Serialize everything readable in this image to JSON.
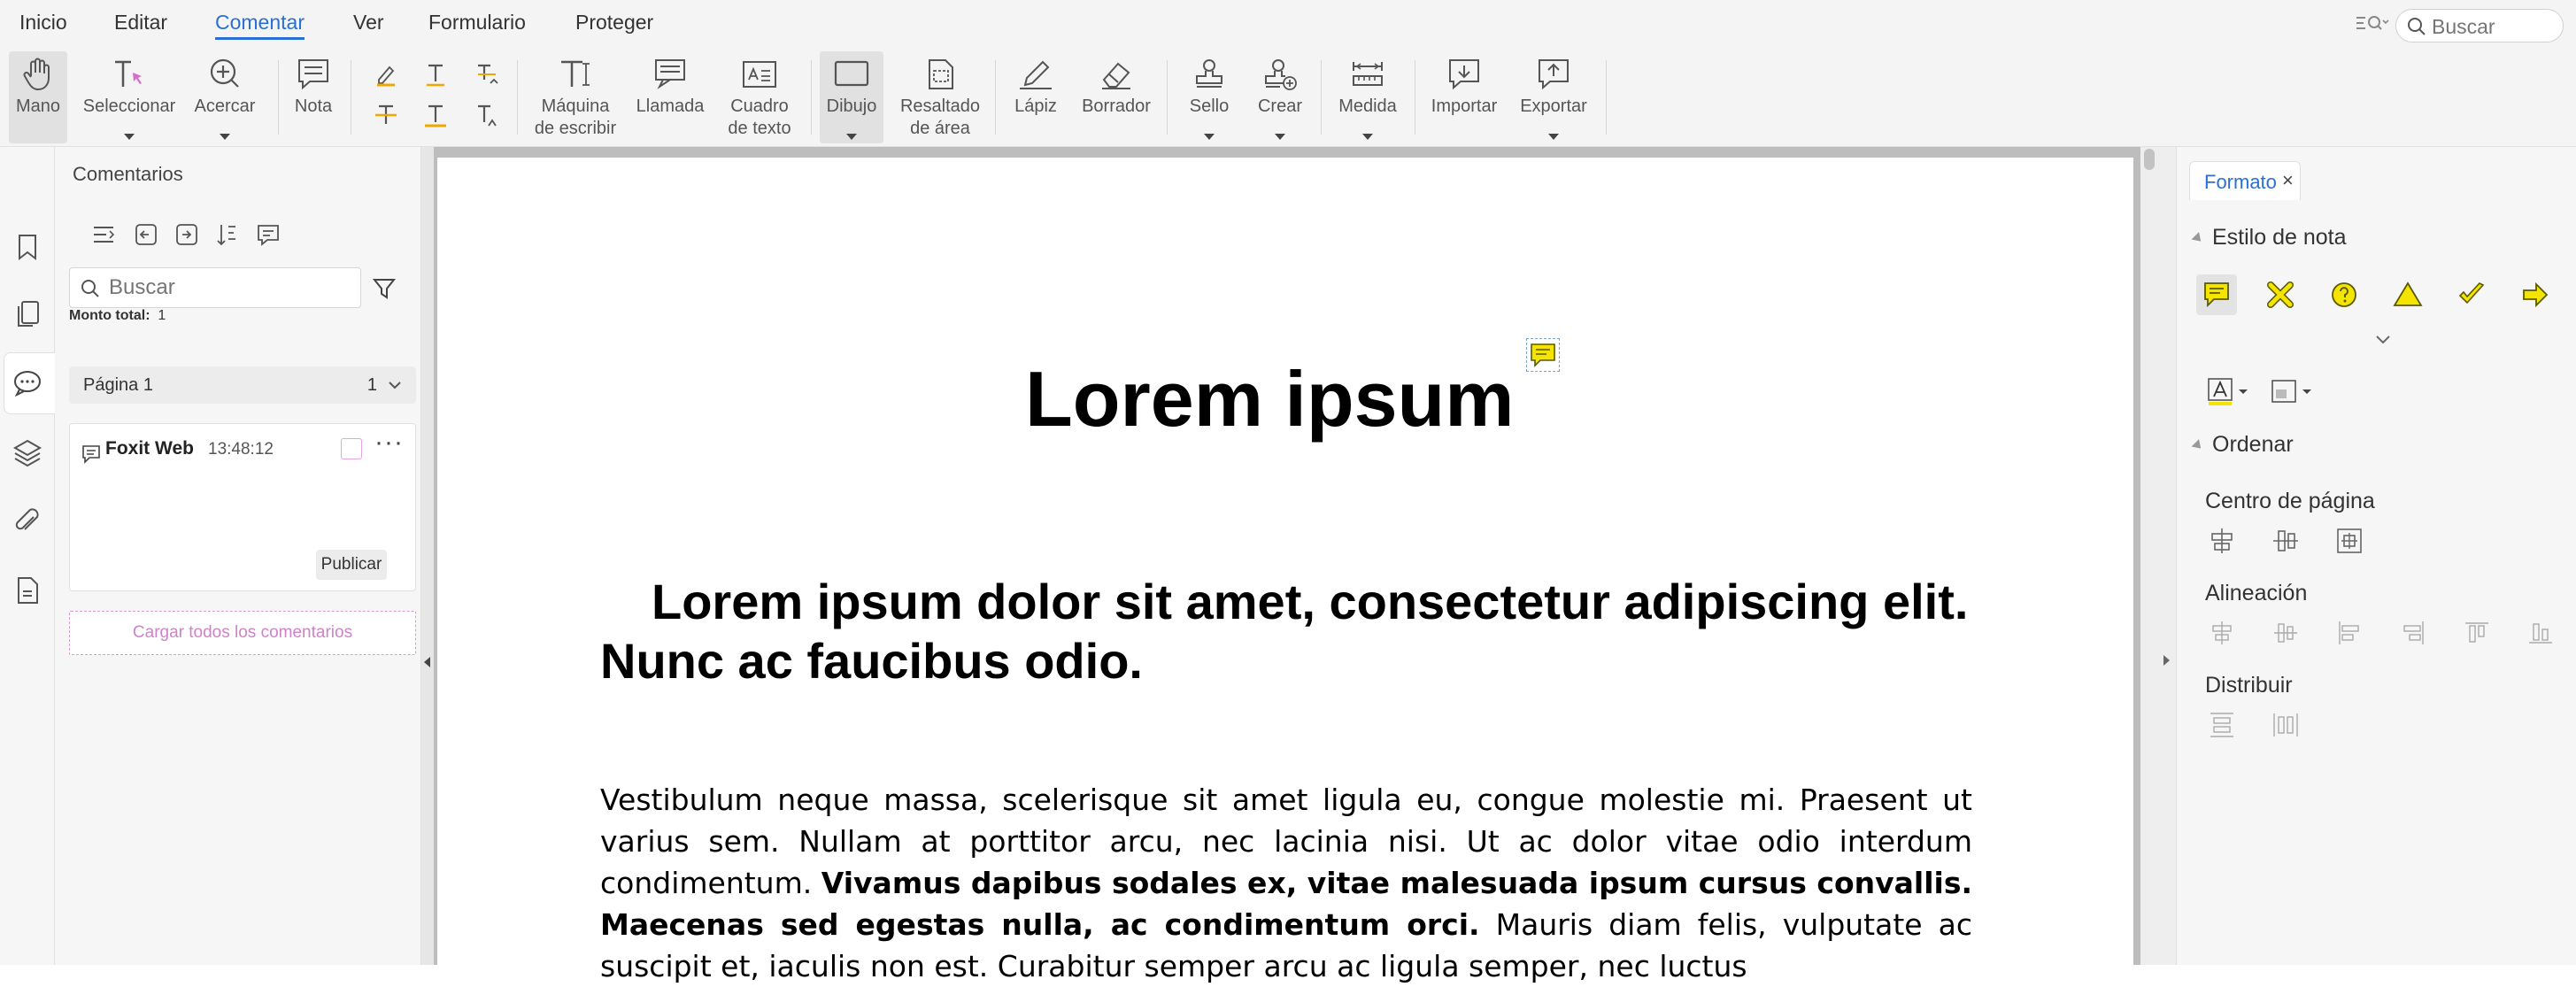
{
  "menu": {
    "items": [
      "Inicio",
      "Editar",
      "Comentar",
      "Ver",
      "Formulario",
      "Proteger"
    ],
    "active": "Comentar",
    "search_placeholder": "Buscar"
  },
  "toolbar": {
    "mano": "Mano",
    "seleccionar": "Seleccionar",
    "acercar": "Acercar",
    "nota": "Nota",
    "maquina_1": "Máquina",
    "maquina_2": "de escribir",
    "llamada": "Llamada",
    "cuadro_1": "Cuadro",
    "cuadro_2": "de texto",
    "dibujo": "Dibujo",
    "resaltado_1": "Resaltado",
    "resaltado_2": "de área",
    "lapiz": "Lápiz",
    "borrador": "Borrador",
    "sello": "Sello",
    "crear": "Crear",
    "medida": "Medida",
    "importar": "Importar",
    "exportar": "Exportar"
  },
  "comments_panel": {
    "title": "Comentarios",
    "search_placeholder": "Buscar",
    "total_label": "Monto total:",
    "total_value": "1",
    "page_label": "Página 1",
    "page_count": "1",
    "comment": {
      "author": "Foxit Web",
      "time": "13:48:12",
      "publish": "Publicar"
    },
    "load_all": "Cargar todos los comentarios"
  },
  "document": {
    "title": "Lorem ipsum",
    "subtitle": "Lorem ipsum dolor sit amet, consectetur adipiscing elit. Nunc ac faucibus odio.",
    "body_1": "Vestibulum neque massa, scelerisque sit amet ligula eu, congue molestie mi. Praesent ut varius sem. Nullam at porttitor arcu, nec lacinia nisi. Ut ac dolor vitae odio interdum condimentum. ",
    "body_bold": "Vivamus dapibus sodales ex, vitae malesuada ipsum cursus convallis. Maecenas sed egestas nulla, ac condimentum orci.",
    "body_2": " Mauris diam felis, vulputate ac suscipit et, iaculis non est. Curabitur semper arcu ac ligula semper, nec luctus"
  },
  "format_panel": {
    "tab": "Formato",
    "estilo": "Estilo de nota",
    "ordenar": "Ordenar",
    "centro": "Centro de página",
    "alineacion": "Alineación",
    "distribuir": "Distribuir"
  },
  "colors": {
    "accent": "#2a6fd6",
    "note_yellow": "#f5e400",
    "note_border": "#5a5a00",
    "publish_pink": "#cf82c8"
  }
}
